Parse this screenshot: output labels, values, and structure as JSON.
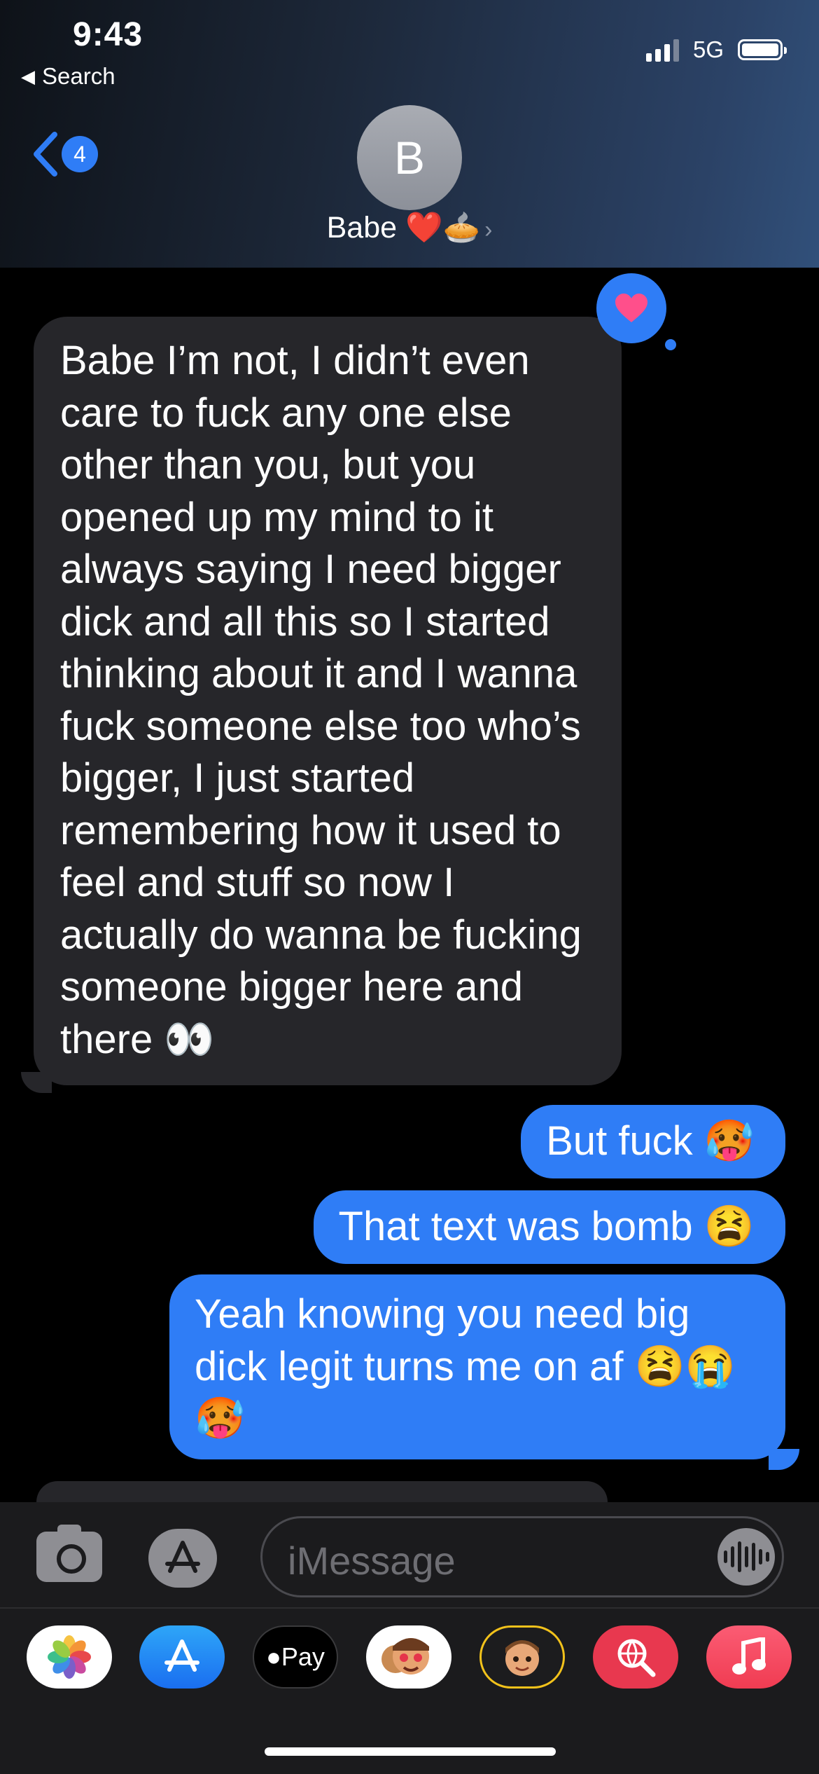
{
  "status_bar": {
    "time": "9:43",
    "back_app": "Search",
    "network": "5G"
  },
  "header": {
    "back_badge": "4",
    "avatar_initial": "B",
    "contact_name": "Babe ❤️🥧",
    "chevron": "›"
  },
  "messages": {
    "received": "Babe I’m not, I didn’t even care to fuck any one else other than you, but you opened up my mind to it always saying I need bigger dick and all this so I started thinking about it and I wanna fuck someone else too who’s bigger, I just started remembering how it used to feel and stuff so now I actually do wanna be fucking someone bigger here and there 👀",
    "sent": [
      "But fuck 🥵",
      "That text was bomb 😫",
      "Yeah knowing you need big dick legit turns me on af 😫😭🥵"
    ]
  },
  "input": {
    "placeholder": "iMessage"
  },
  "app_tray": [
    {
      "icon": "photos-icon"
    },
    {
      "icon": "app-store-icon"
    },
    {
      "icon": "apple-pay-icon",
      "label": "Pay"
    },
    {
      "icon": "memoji-stickers-icon"
    },
    {
      "icon": "memoji-icon"
    },
    {
      "icon": "web-search-icon"
    },
    {
      "icon": "music-icon"
    }
  ],
  "colors": {
    "sent_bubble": "#2f7df6",
    "received_bubble": "#26262a",
    "background": "#000000"
  }
}
